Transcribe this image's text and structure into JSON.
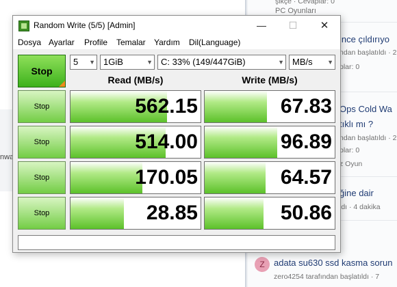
{
  "background": {
    "left_text": "nwa",
    "right_items": [
      {
        "title": "PC Oyunları",
        "meta": ""
      },
      {
        "title": "ince çıldırıyo",
        "meta": "ndan başlatıldı · 2"
      },
      {
        "title": "",
        "meta": "plar: 0"
      },
      {
        "title": "Ops Cold Wa",
        "meta": ""
      },
      {
        "title": "tıklı mı ?",
        "meta": "ndan başlatıldı · 2"
      },
      {
        "title": "",
        "meta": "plar: 0"
      },
      {
        "title": "",
        "meta": "z Oyun"
      },
      {
        "title": "ğine dair",
        "meta": "ldı · 4 dakika"
      },
      {
        "title": "adata su630 ssd kasma sorun",
        "meta": "zero4254 tarafından başlatıldı · 7"
      }
    ],
    "top_meta": "şikçe · Cevaplar: 0",
    "avatar_letter": "Z"
  },
  "window": {
    "title": "Random Write (5/5) [Admin]",
    "controls": {
      "minimize": "—",
      "maximize": "☐",
      "close": "✕"
    }
  },
  "menu": [
    "Dosya",
    "Ayarlar",
    "Profile",
    "Temalar",
    "Yardım",
    "Dil(Language)"
  ],
  "toolbar": {
    "stop_all_label": "Stop",
    "count_value": "5",
    "size_value": "1GiB",
    "drive_value": "C: 33% (149/447GiB)",
    "unit_value": "MB/s"
  },
  "headers": {
    "read": "Read (MB/s)",
    "write": "Write (MB/s)"
  },
  "rows": [
    {
      "stop_label": "Stop",
      "read": "562.15",
      "write": "67.83",
      "read_fill": 0.74,
      "write_fill": 0.48
    },
    {
      "stop_label": "Stop",
      "read": "514.00",
      "write": "96.89",
      "read_fill": 0.73,
      "write_fill": 0.56
    },
    {
      "stop_label": "Stop",
      "read": "170.05",
      "write": "64.57",
      "read_fill": 0.55,
      "write_fill": 0.47
    },
    {
      "stop_label": "Stop",
      "read": "28.85",
      "write": "50.86",
      "read_fill": 0.41,
      "write_fill": 0.45
    }
  ],
  "comment": ""
}
